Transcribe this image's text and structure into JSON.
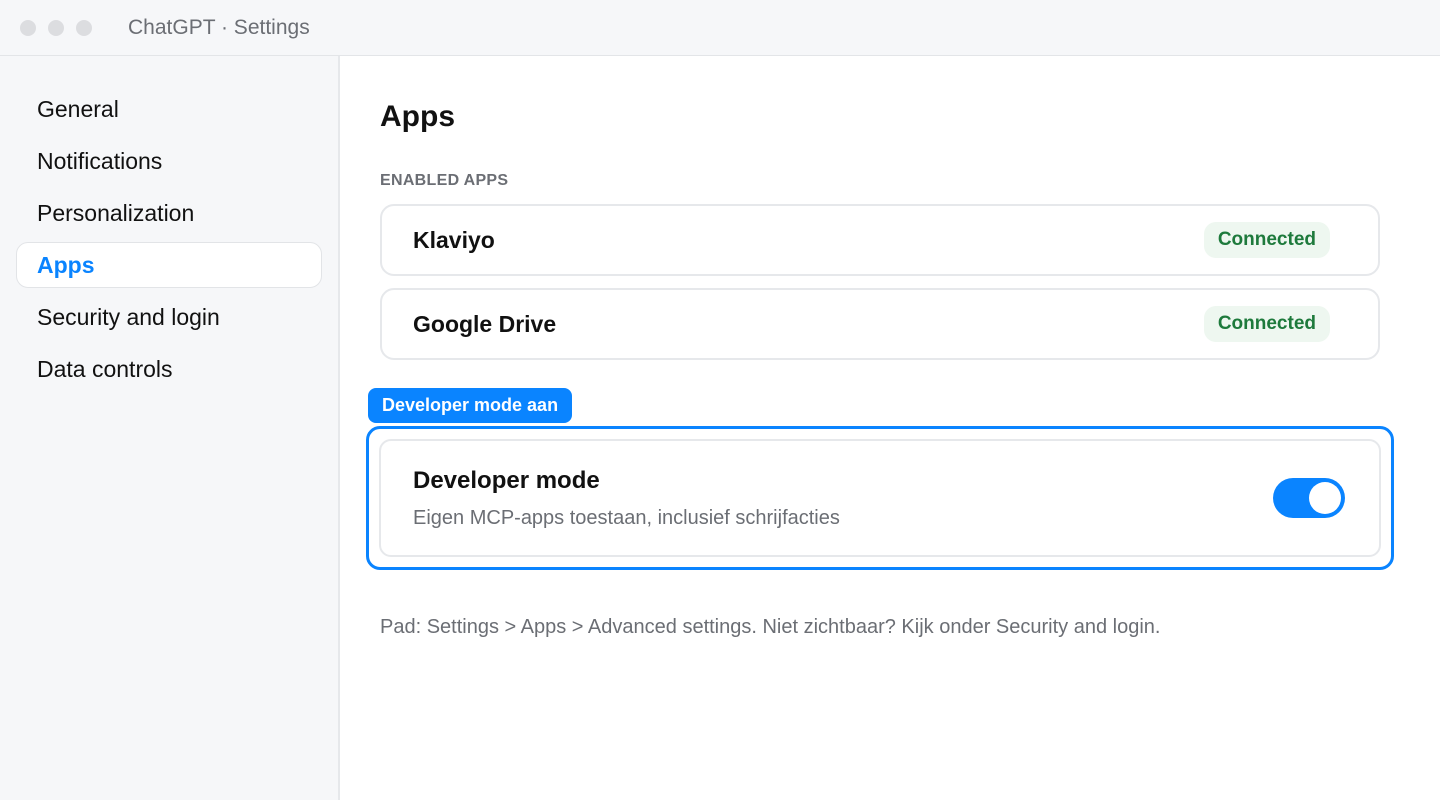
{
  "window": {
    "title": "ChatGPT · Settings"
  },
  "sidebar": {
    "items": [
      {
        "label": "General",
        "active": false
      },
      {
        "label": "Notifications",
        "active": false
      },
      {
        "label": "Personalization",
        "active": false
      },
      {
        "label": "Apps",
        "active": true
      },
      {
        "label": "Security and login",
        "active": false
      },
      {
        "label": "Data controls",
        "active": false
      }
    ]
  },
  "main": {
    "title": "Apps",
    "enabled_section_label": "ENABLED APPS",
    "apps": [
      {
        "name": "Klaviyo",
        "status": "Connected"
      },
      {
        "name": "Google Drive",
        "status": "Connected"
      }
    ],
    "developer": {
      "tag": "Developer mode aan",
      "title": "Developer mode",
      "description": "Eigen MCP-apps toestaan, inclusief schrijfacties",
      "enabled": true
    },
    "path_hint": "Pad: Settings > Apps > Advanced settings. Niet zichtbaar? Kijk onder Security and login."
  },
  "colors": {
    "accent": "#0a84ff",
    "connected_text": "#1e7a3c",
    "connected_bg": "#eef7f0"
  }
}
